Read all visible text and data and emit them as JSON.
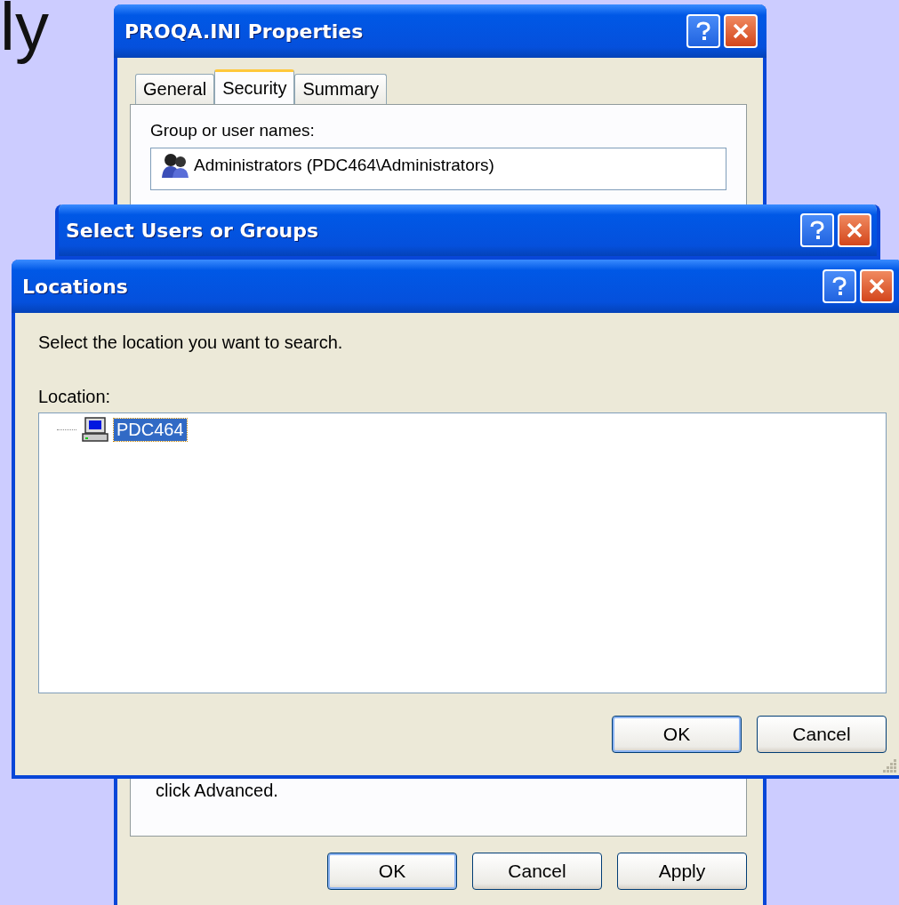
{
  "slide_text": "ly",
  "properties_window": {
    "title": "PROQA.INI Properties",
    "tabs": [
      {
        "label": "General",
        "selected": false
      },
      {
        "label": "Security",
        "selected": true
      },
      {
        "label": "Summary",
        "selected": false
      }
    ],
    "group_label": "Group or user names:",
    "users": [
      {
        "name": "Administrators (PDC464\\Administrators)"
      }
    ],
    "hint": "click Advanced.",
    "buttons": [
      {
        "label": "OK",
        "default": true
      },
      {
        "label": "Cancel",
        "default": false
      },
      {
        "label": "Apply",
        "default": false
      }
    ]
  },
  "select_users_window": {
    "title": "Select Users or Groups"
  },
  "locations_window": {
    "title": "Locations",
    "prompt": "Select the location you want to search.",
    "location_label": "Location:",
    "tree": [
      {
        "label": "PDC464",
        "selected": true
      }
    ],
    "buttons": [
      {
        "label": "OK",
        "default": true
      },
      {
        "label": "Cancel",
        "default": false
      }
    ]
  }
}
